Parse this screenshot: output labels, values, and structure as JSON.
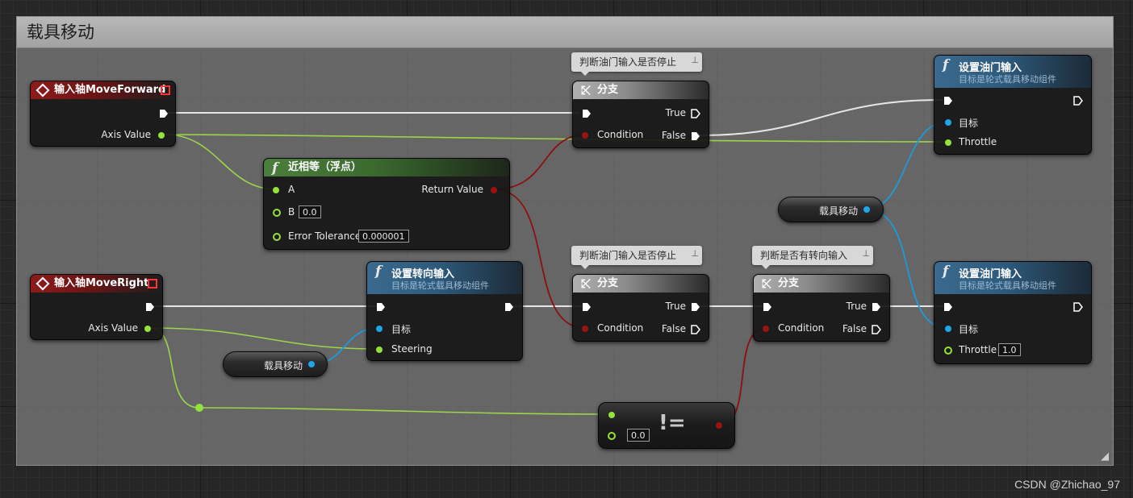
{
  "comment": {
    "title": "载具移动"
  },
  "watermark": "CSDN @Zhichao_97",
  "icons": {
    "function": "f",
    "branch": "branch-icon",
    "event": "event-diamond-icon"
  },
  "colors": {
    "exec": "#ffffff",
    "float_pin": "#94e23c",
    "object_pin": "#1fa6e8",
    "bool_pin": "#9a1212",
    "event_header": "#8e1b1b",
    "function_header": "#3b6a8e",
    "pure_header": "#4b7d3c",
    "comment_title": "#a8a8a8"
  },
  "nodes": {
    "move_forward_event": {
      "title": "输入轴MoveForward",
      "output_label": "Axis Value"
    },
    "move_right_event": {
      "title": "输入轴MoveRight",
      "output_label": "Axis Value"
    },
    "nearly_equal": {
      "title": "近相等（浮点）",
      "pin_a": "A",
      "pin_b": "B",
      "b_value": "0.0",
      "pin_tol": "Error Tolerance",
      "tol_value": "0.000001",
      "return_label": "Return Value"
    },
    "branch_1": {
      "title": "分支",
      "comment": "判断油门输入是否停止",
      "condition": "Condition",
      "true_label": "True",
      "false_label": "False"
    },
    "branch_2": {
      "title": "分支",
      "comment": "判断油门输入是否停止",
      "condition": "Condition",
      "true_label": "True",
      "false_label": "False"
    },
    "branch_3": {
      "title": "分支",
      "comment": "判断是否有转向输入",
      "condition": "Condition",
      "true_label": "True",
      "false_label": "False"
    },
    "set_throttle_1": {
      "title": "设置油门输入",
      "subtitle": "目标是轮式载具移动组件",
      "target": "目标",
      "throttle": "Throttle"
    },
    "set_throttle_2": {
      "title": "设置油门输入",
      "subtitle": "目标是轮式载具移动组件",
      "target": "目标",
      "throttle": "Throttle",
      "throttle_value": "1.0"
    },
    "set_steering": {
      "title": "设置转向输入",
      "subtitle": "目标是轮式载具移动组件",
      "target": "目标",
      "steering": "Steering"
    },
    "vehicle_movement_var_1": {
      "label": "载具移动"
    },
    "vehicle_movement_var_2": {
      "label": "载具移动"
    },
    "not_equal": {
      "operator": "!=",
      "b_value": "0.0"
    }
  }
}
